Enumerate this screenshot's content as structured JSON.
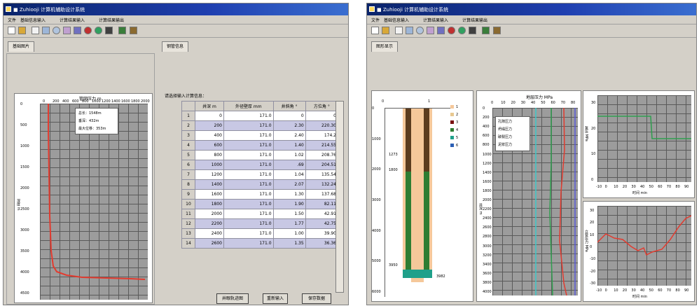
{
  "colors": {
    "curve": "#e23b2f",
    "green_line": "#2e9e4e",
    "cyan_line": "#3cc8c8",
    "blue_line": "#5b5bd8"
  },
  "left_window": {
    "title": "■ Zuhiooji 计算机辅助设计系统",
    "menu": [
      "文件",
      "基础信息输入",
      "计算结果输入",
      "计算结果输出"
    ],
    "tabs": [
      "基础图片",
      "钢管信息"
    ],
    "plot": {
      "title": "管网压力 m",
      "x_ticks": [
        "0",
        "200",
        "400",
        "600",
        "800",
        "1000",
        "1200",
        "1400",
        "1600",
        "1800",
        "2000"
      ],
      "y_ticks": [
        "0",
        "500",
        "1000",
        "1500",
        "2000",
        "2500",
        "3000",
        "3500",
        "4000",
        "4500"
      ],
      "y_label": "深度 m",
      "legend": [
        "总长：1548m",
        "垂深：432m",
        "最大位移：353m"
      ]
    },
    "table_title": "请选择输入计算信息：",
    "headers": [
      "井深 m",
      "外径壁厚 mm",
      "井斜角 °",
      "方位角 °"
    ],
    "rows": [
      [
        "1",
        "0",
        "171.0",
        "0",
        "0"
      ],
      [
        "2",
        "200",
        "171.0",
        "2.30",
        "220.30"
      ],
      [
        "3",
        "400",
        "171.0",
        "2.40",
        "174.2"
      ],
      [
        "4",
        "600",
        "171.0",
        "1.40",
        "214.55"
      ],
      [
        "5",
        "800",
        "171.0",
        "1.02",
        "208.76"
      ],
      [
        "6",
        "1000",
        "171.0",
        ".69",
        "204.51"
      ],
      [
        "7",
        "1200",
        "171.0",
        "1.04",
        "135.54"
      ],
      [
        "8",
        "1400",
        "171.0",
        "2.07",
        "132.24"
      ],
      [
        "9",
        "1600",
        "171.0",
        "1.30",
        "137.68"
      ],
      [
        "10",
        "1800",
        "171.0",
        "1.90",
        "82.11"
      ],
      [
        "11",
        "2000",
        "171.0",
        "1.50",
        "42.91"
      ],
      [
        "12",
        "2200",
        "171.0",
        "1.77",
        "42.75"
      ],
      [
        "13",
        "2400",
        "171.0",
        "1.00",
        "39.90"
      ],
      [
        "14",
        "2600",
        "171.0",
        "1.35",
        "36.36"
      ]
    ],
    "buttons": [
      "井眼轨迹图",
      "重新输入",
      "保存数据"
    ]
  },
  "right_window": {
    "title": "■ Zuhiooji 计算机辅助设计系统",
    "menu": [
      "文件",
      "基础信息输入",
      "计算结果输入",
      "计算结果输出"
    ],
    "tabs": [
      "图形显示"
    ],
    "well": {
      "x_ticks": [
        "0",
        "1"
      ],
      "y_ticks": [
        "0",
        "1000",
        "2000",
        "3000",
        "4000",
        "5000",
        "6000"
      ],
      "markers": [
        "1273",
        "1800",
        "3950",
        "3982"
      ],
      "legend": [
        "1",
        "2",
        "3",
        "4",
        "5",
        "6"
      ],
      "legend_colors": [
        "#f5c89a",
        "#e8c890",
        "#7a1010",
        "#2e7d32",
        "#1fa08a",
        "#2b5fb5"
      ]
    },
    "pressure": {
      "title": "地层压力 MPa",
      "x_ticks": [
        "0",
        "10",
        "20",
        "30",
        "40",
        "50",
        "60",
        "70",
        "80"
      ],
      "y_ticks": [
        "0",
        "200",
        "400",
        "600",
        "800",
        "1000",
        "1200",
        "1400",
        "1600",
        "1800",
        "2000",
        "2200",
        "2400",
        "2600",
        "2800",
        "3000",
        "3200",
        "3400",
        "3600",
        "3800",
        "4000"
      ],
      "y_label": "井深 m",
      "legend": [
        "孔隙压力",
        "坍塌压力",
        "破裂压力",
        "泥浆压力"
      ]
    },
    "top_small": {
      "x_ticks": [
        "-10",
        "0",
        "10",
        "20",
        "30",
        "40",
        "50",
        "60",
        "70",
        "80",
        "90"
      ],
      "x_label": "时间 min",
      "y_label": "泵压 MPa",
      "y_ticks": [
        "0",
        "10",
        "20",
        "30"
      ]
    },
    "bottom_small": {
      "x_ticks": [
        "-10",
        "0",
        "10",
        "20",
        "30",
        "40",
        "50",
        "60",
        "70",
        "80",
        "90"
      ],
      "x_label": "时间 min",
      "y_label": "立管压力 MPa",
      "y_ticks": [
        "-30",
        "-20",
        "-10",
        "0",
        "10",
        "20",
        "30"
      ]
    }
  }
}
